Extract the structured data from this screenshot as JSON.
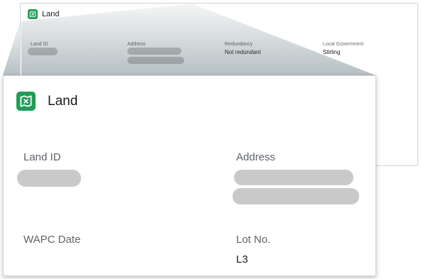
{
  "app": {
    "title": "Land",
    "icon": "map-icon",
    "brand_color": "#1f9d55"
  },
  "background_card": {
    "fields": [
      {
        "label": "Land ID",
        "value": ""
      },
      {
        "label": "Address",
        "value": ""
      },
      {
        "label": "Redundancy",
        "value": "Not redundant"
      },
      {
        "label": "Local Government",
        "value": "Stirling"
      }
    ]
  },
  "detail_card": {
    "fields": [
      {
        "label": "Land ID",
        "value": ""
      },
      {
        "label": "Address",
        "value": ""
      },
      {
        "label": "WAPC Date",
        "value": ""
      },
      {
        "label": "Lot No.",
        "value": "L3"
      }
    ]
  },
  "redacted_placeholder_color": "#c9c9c9"
}
